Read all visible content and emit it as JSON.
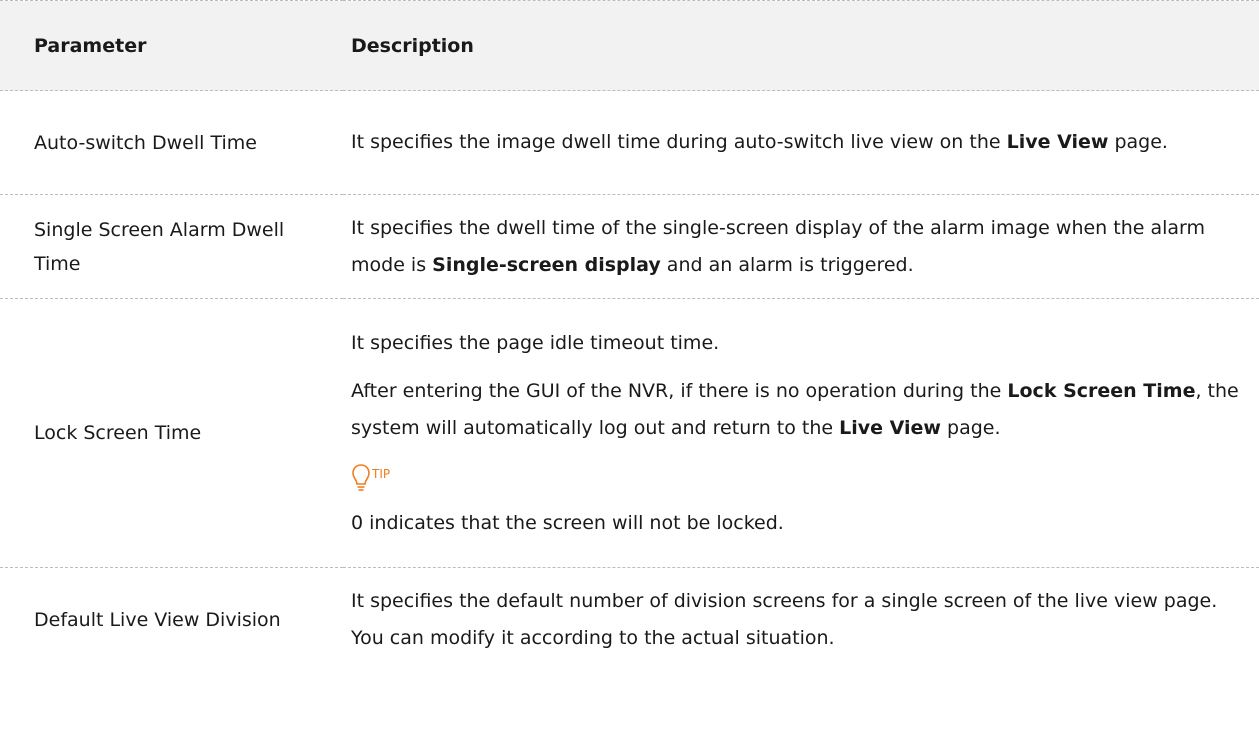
{
  "table": {
    "header": {
      "parameter": "Parameter",
      "description": "Description"
    },
    "rows": [
      {
        "parameter": "Auto-switch Dwell Time",
        "description": {
          "a": "It specifies the image dwell time during auto-switch live view on the ",
          "b1": "Live View",
          "c": " page."
        }
      },
      {
        "parameter": "Single Screen Alarm Dwell Time",
        "description": {
          "a": "It specifies the dwell time of the single-screen display of the alarm image when the alarm mode is ",
          "b1": "Single-screen display",
          "c": " and an alarm is triggered."
        }
      },
      {
        "parameter": "Lock Screen Time",
        "description": {
          "p1": "It specifies the page idle timeout time.",
          "p2a": "After entering the GUI of the NVR, if there is no operation during the ",
          "p2b": "Lock Screen Time",
          "p2c": ", the system will automatically log out and return to the ",
          "p2d": "Live View",
          "p2e": " page.",
          "tip_label": "TIP",
          "tip_text": "0 indicates that the screen will not be locked."
        }
      },
      {
        "parameter": "Default Live View Division",
        "description": {
          "a": "It specifies the default number of division screens for a single screen of the live view page. You can modify it according to the actual situation."
        }
      }
    ]
  },
  "colors": {
    "header_bg": "#f2f2f2",
    "border": "#bdbdbd",
    "tip": "#f07d1f"
  },
  "icons": {
    "tip": "lightbulb-icon"
  }
}
